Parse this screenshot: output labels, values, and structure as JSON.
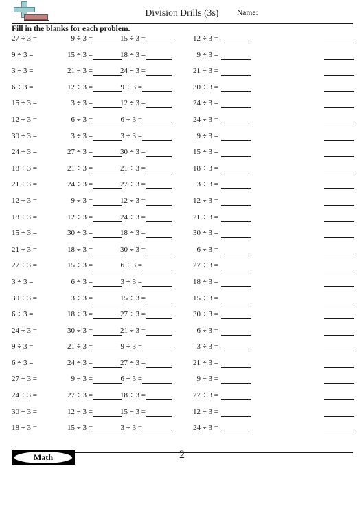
{
  "header": {
    "title": "Division Drills (3s)",
    "name_label": "Name:",
    "instructions": "Fill in the blanks for each problem.",
    "logo_icon": "math-cross-logo"
  },
  "footer": {
    "badge_label": "Math",
    "page_number": "2"
  },
  "worksheet": {
    "columns": 5,
    "rows": 24,
    "divisor": 3,
    "blank_column_index": 4,
    "grid": [
      [
        "27 ÷ 3 =",
        "9 ÷ 3 =",
        "15 ÷ 3 =",
        "12 ÷ 3 =",
        ""
      ],
      [
        "9 ÷ 3 =",
        "15 ÷ 3 =",
        "18 ÷ 3 =",
        "9 ÷ 3 =",
        ""
      ],
      [
        "3 ÷ 3 =",
        "21 ÷ 3 =",
        "24 ÷ 3 =",
        "21 ÷ 3 =",
        ""
      ],
      [
        "6 ÷ 3 =",
        "12 ÷ 3 =",
        "9 ÷ 3 =",
        "30 ÷ 3 =",
        ""
      ],
      [
        "15 ÷ 3 =",
        "3 ÷ 3 =",
        "12 ÷ 3 =",
        "24 ÷ 3 =",
        ""
      ],
      [
        "12 ÷ 3 =",
        "6 ÷ 3 =",
        "6 ÷ 3 =",
        "24 ÷ 3 =",
        ""
      ],
      [
        "30 ÷ 3 =",
        "3 ÷ 3 =",
        "3 ÷ 3 =",
        "9 ÷ 3 =",
        ""
      ],
      [
        "24 ÷ 3 =",
        "27 ÷ 3 =",
        "30 ÷ 3 =",
        "15 ÷ 3 =",
        ""
      ],
      [
        "18 ÷ 3 =",
        "21 ÷ 3 =",
        "21 ÷ 3 =",
        "18 ÷ 3 =",
        ""
      ],
      [
        "21 ÷ 3 =",
        "24 ÷ 3 =",
        "27 ÷ 3 =",
        "3 ÷ 3 =",
        ""
      ],
      [
        "12 ÷ 3 =",
        "9 ÷ 3 =",
        "12 ÷ 3 =",
        "12 ÷ 3 =",
        ""
      ],
      [
        "18 ÷ 3 =",
        "12 ÷ 3 =",
        "24 ÷ 3 =",
        "21 ÷ 3 =",
        ""
      ],
      [
        "15 ÷ 3 =",
        "30 ÷ 3 =",
        "18 ÷ 3 =",
        "30 ÷ 3 =",
        ""
      ],
      [
        "21 ÷ 3 =",
        "18 ÷ 3 =",
        "30 ÷ 3 =",
        "6 ÷ 3 =",
        ""
      ],
      [
        "27 ÷ 3 =",
        "15 ÷ 3 =",
        "6 ÷ 3 =",
        "27 ÷ 3 =",
        ""
      ],
      [
        "3 ÷ 3 =",
        "6 ÷ 3 =",
        "3 ÷ 3 =",
        "18 ÷ 3 =",
        ""
      ],
      [
        "30 ÷ 3 =",
        "3 ÷ 3 =",
        "15 ÷ 3 =",
        "15 ÷ 3 =",
        ""
      ],
      [
        "6 ÷ 3 =",
        "18 ÷ 3 =",
        "27 ÷ 3 =",
        "30 ÷ 3 =",
        ""
      ],
      [
        "24 ÷ 3 =",
        "30 ÷ 3 =",
        "21 ÷ 3 =",
        "6 ÷ 3 =",
        ""
      ],
      [
        "9 ÷ 3 =",
        "21 ÷ 3 =",
        "9 ÷ 3 =",
        "3 ÷ 3 =",
        ""
      ],
      [
        "6 ÷ 3 =",
        "24 ÷ 3 =",
        "27 ÷ 3 =",
        "21 ÷ 3 =",
        ""
      ],
      [
        "27 ÷ 3 =",
        "9 ÷ 3 =",
        "6 ÷ 3 =",
        "9 ÷ 3 =",
        ""
      ],
      [
        "24 ÷ 3 =",
        "27 ÷ 3 =",
        "18 ÷ 3 =",
        "27 ÷ 3 =",
        ""
      ],
      [
        "30 ÷ 3 =",
        "12 ÷ 3 =",
        "15 ÷ 3 =",
        "12 ÷ 3 =",
        ""
      ],
      [
        "18 ÷ 3 =",
        "15 ÷ 3 =",
        "3 ÷ 3 =",
        "24 ÷ 3 =",
        ""
      ]
    ]
  }
}
